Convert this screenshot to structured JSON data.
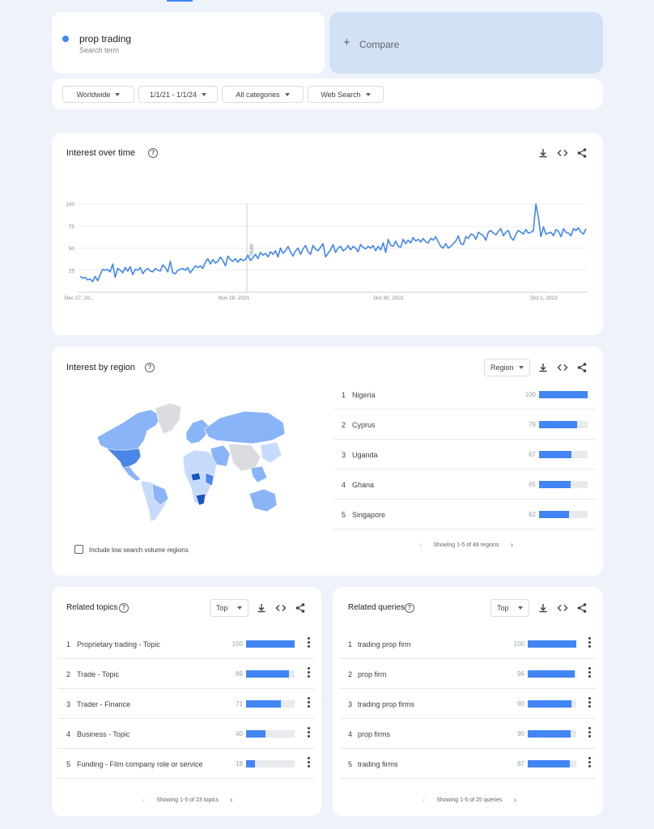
{
  "search_term": {
    "name": "prop trading",
    "subtitle": "Search term"
  },
  "compare": {
    "label": "Compare"
  },
  "filters": [
    {
      "label": "Worldwide"
    },
    {
      "label": "1/1/21 - 1/1/24"
    },
    {
      "label": "All categories"
    },
    {
      "label": "Web Search"
    }
  ],
  "interest_over_time": {
    "title": "Interest over time",
    "note_label": "Note",
    "chart_data": {
      "type": "line",
      "title": "",
      "xlabel": "",
      "ylabel": "",
      "ylim": [
        0,
        100
      ],
      "yticks": [
        25,
        50,
        75,
        100
      ],
      "xtick_labels": [
        "Dec 27, 20...",
        "Nov 28, 2021",
        "Oct 30, 2022",
        "Oct 1, 2023"
      ],
      "grid": true,
      "color": "#4285f4",
      "series": [
        {
          "values": [
            18,
            16,
            17,
            14,
            15,
            12,
            18,
            13,
            20,
            26,
            25,
            26,
            23,
            32,
            17,
            27,
            25,
            22,
            28,
            24,
            29,
            20,
            26,
            25,
            28,
            21,
            25,
            27,
            24,
            23,
            27,
            25,
            24,
            31,
            28,
            23,
            35,
            22,
            21,
            25,
            26,
            27,
            25,
            28,
            22,
            26,
            30,
            28,
            30,
            27,
            34,
            38,
            32,
            37,
            33,
            35,
            40,
            36,
            30,
            41,
            37,
            35,
            38,
            34,
            38,
            36,
            37,
            42,
            36,
            39,
            43,
            38,
            45,
            42,
            44,
            40,
            46,
            43,
            47,
            40,
            50,
            44,
            47,
            52,
            46,
            41,
            47,
            50,
            43,
            49,
            53,
            46,
            43,
            53,
            49,
            47,
            51,
            55,
            40,
            44,
            48,
            54,
            45,
            50,
            52,
            47,
            49,
            53,
            48,
            52,
            50,
            46,
            54,
            51,
            49,
            52,
            50,
            53,
            47,
            52,
            48,
            56,
            45,
            60,
            53,
            52,
            58,
            52,
            51,
            60,
            55,
            59,
            56,
            62,
            58,
            60,
            57,
            61,
            57,
            56,
            61,
            59,
            63,
            57,
            52,
            50,
            55,
            50,
            52,
            55,
            58,
            64,
            55,
            54,
            63,
            61,
            66,
            65,
            60,
            68,
            66,
            64,
            59,
            68,
            70,
            67,
            65,
            69,
            72,
            64,
            68,
            70,
            62,
            59,
            66,
            70,
            68,
            66,
            71,
            67,
            68,
            70,
            100,
            85,
            63,
            74,
            66,
            67,
            68,
            64,
            71,
            69,
            63,
            72,
            68,
            67,
            64,
            72,
            70,
            73,
            68,
            66,
            72
          ]
        }
      ]
    }
  },
  "interest_by_region": {
    "title": "Interest by region",
    "dropdown": "Region",
    "checkbox_label": "Include low search volume regions",
    "pager": "Showing 1-5 of 48 regions",
    "rows": [
      {
        "rank": "1",
        "label": "Nigeria",
        "value": "100",
        "pct": 100
      },
      {
        "rank": "2",
        "label": "Cyprus",
        "value": "79",
        "pct": 79
      },
      {
        "rank": "3",
        "label": "Uganda",
        "value": "67",
        "pct": 67
      },
      {
        "rank": "4",
        "label": "Ghana",
        "value": "65",
        "pct": 65
      },
      {
        "rank": "5",
        "label": "Singapore",
        "value": "62",
        "pct": 62
      }
    ]
  },
  "related_topics": {
    "title": "Related topics",
    "dropdown": "Top",
    "pager": "Showing 1-5 of 23 topics",
    "rows": [
      {
        "rank": "1",
        "label": "Proprietary trading - Topic",
        "value": "100",
        "pct": 100
      },
      {
        "rank": "2",
        "label": "Trade - Topic",
        "value": "89",
        "pct": 89
      },
      {
        "rank": "3",
        "label": "Trader - Finance",
        "value": "71",
        "pct": 71
      },
      {
        "rank": "4",
        "label": "Business - Topic",
        "value": "40",
        "pct": 40
      },
      {
        "rank": "5",
        "label": "Funding - Film company role or service",
        "value": "18",
        "pct": 18
      }
    ]
  },
  "related_queries": {
    "title": "Related queries",
    "dropdown": "Top",
    "pager": "Showing 1-5 of 25 queries",
    "rows": [
      {
        "rank": "1",
        "label": "trading prop firm",
        "value": "100",
        "pct": 100
      },
      {
        "rank": "2",
        "label": "prop firm",
        "value": "96",
        "pct": 96
      },
      {
        "rank": "3",
        "label": "trading prop firms",
        "value": "90",
        "pct": 90
      },
      {
        "rank": "4",
        "label": "prop firms",
        "value": "90",
        "pct": 89
      },
      {
        "rank": "5",
        "label": "trading firms",
        "value": "87",
        "pct": 86
      }
    ]
  },
  "colors": {
    "accent": "#4285f4",
    "map_high": "#1a56c4",
    "map_mid": "#8ab4f8",
    "map_low": "#c6dafc",
    "map_none": "#dadce0"
  },
  "icons": {
    "download": "download-icon",
    "embed": "embed-icon",
    "share": "share-icon",
    "help": "help-icon"
  }
}
